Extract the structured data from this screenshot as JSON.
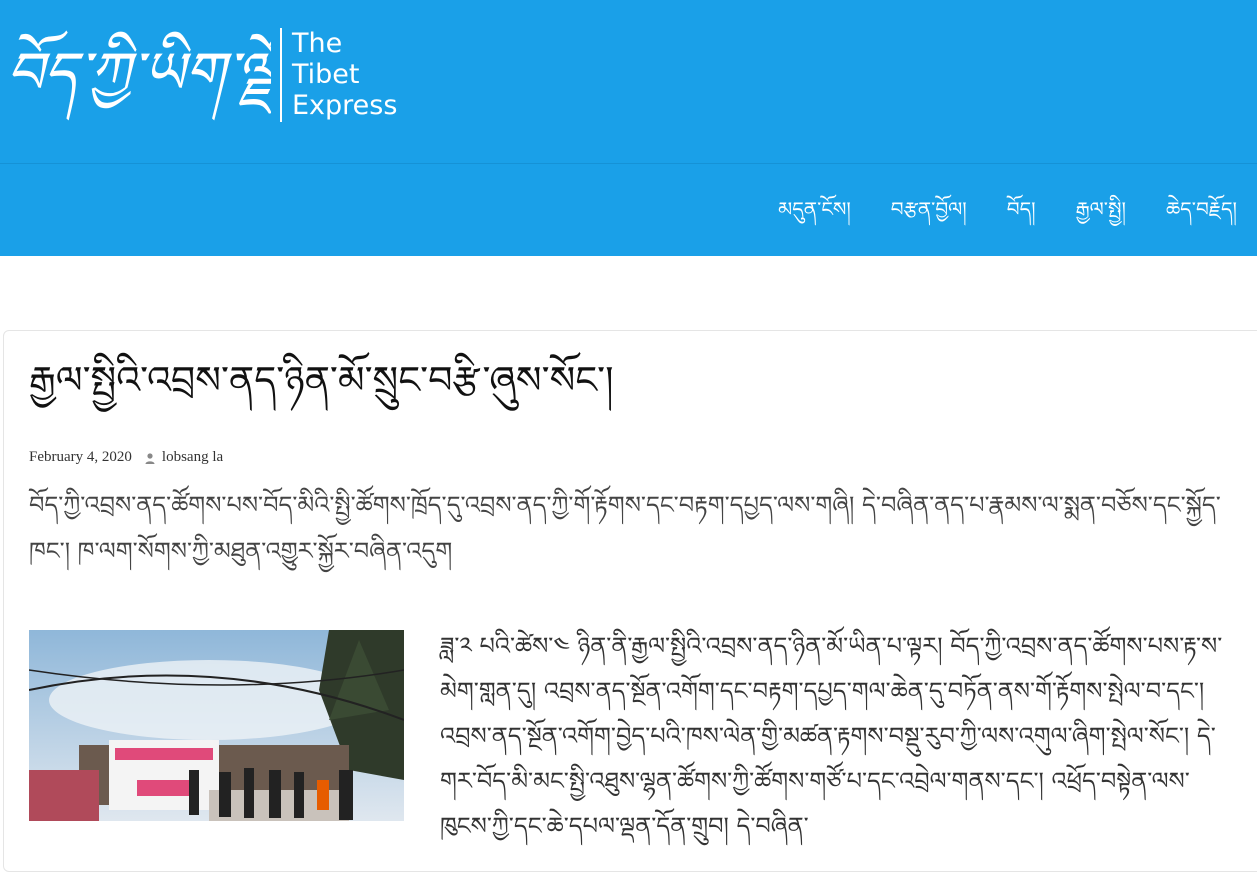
{
  "header": {
    "logo_tibetan": "བོད་ཀྱི་ཡིག་ལྗོངས།",
    "logo_english": [
      "The",
      "Tibet",
      "Express"
    ]
  },
  "nav": {
    "items": [
      "མདུན་ངོས།",
      "བརྩན་བྱོལ།",
      "བོད།",
      "རྒྱལ་སྤྱི།",
      "ཆེད་བརྗོད།"
    ]
  },
  "post": {
    "title": "རྒྱལ་སྤྱིའི་འབྲས་ནད་ཉིན་མོ་སྲུང་བརྩི་ཞུས་སོང་།",
    "date": "February 4, 2020",
    "author": "lobsang la",
    "lead": "བོད་ཀྱི་འབྲས་ནད་ཚོགས་པས་བོད་མིའི་སྤྱི་ཚོགས་ཁྲོད་དུ་འབྲས་ནད་ཀྱི་གོ་རྟོགས་དང་བརྟག་དཔྱད་ལས་གཞི། དེ་བཞིན་ནད་པ་རྣམས་ལ་སྨན་བཅོས་དང་སྐྱོད་ཁང་། ཁ་ལག་སོགས་ཀྱི་མཐུན་འགྱུར་སྐྱོར་བཞིན་འདུག",
    "body": "ཟླ་༢ པའི་ཚེས་༤ ཉིན་ནི་རྒྱལ་སྤྱིའི་འབྲས་ནད་ཉིན་མོ་ཡིན་པ་ལྟར། བོད་ཀྱི་འབྲས་ནད་ཚོགས་པས་རྟ་ས་མེག་གླན་དུ། འབྲས་ནད་སྔོན་འགོག་དང་བརྟག་དཔྱད་གལ་ཆེན་དུ་བཏོན་ནས་གོ་རྟོགས་སྤེལ་བ་དང་། འབྲས་ནད་སྔོན་འགོག་བྱེད་པའི་ཁས་ལེན་གྱི་མཚན་རྟགས་བསྡུ་རུབ་ཀྱི་ལས་འགུལ་ཞིག་སྤེལ་སོང་། དེ་གར་བོད་མི་མང་སྤྱི་འཐུས་ལྷན་ཚོགས་ཀྱི་ཚོགས་གཙོ་པ་དང་འབྲེལ་གནས་དང་། འཕྲོད་བསྟེན་ལས་ཁུངས་ཀྱི་དང་ཆེ་དཔལ་ལྡན་དོན་གྲུབ། དེ་བཞིན་"
  }
}
